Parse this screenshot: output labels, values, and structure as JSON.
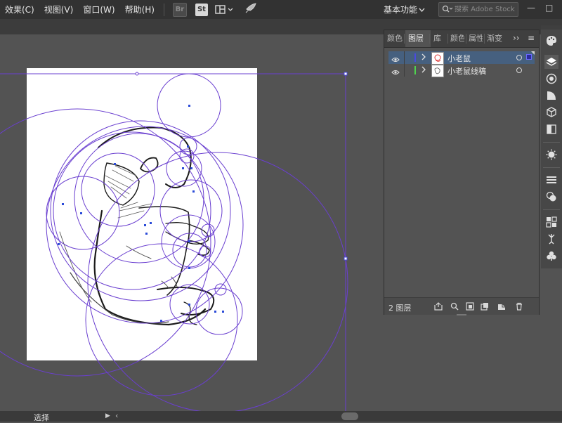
{
  "menubar": {
    "items": [
      "效果(C)",
      "视图(V)",
      "窗口(W)",
      "帮助(H)"
    ],
    "bridge_label": "Br",
    "stock_label": "St",
    "workspace": "基本功能",
    "search_placeholder": "搜索 Adobe Stock",
    "minimize": "—",
    "restore": "□"
  },
  "status": {
    "tool": "选择",
    "arrow": "▶",
    "scroll_left": "‹"
  },
  "layers_panel": {
    "tabs": [
      "颜色",
      "图层",
      "库",
      "颜色",
      "属性",
      "渐变"
    ],
    "active_tab": "图层",
    "overflow": "››",
    "menu": "≡",
    "layers": [
      {
        "name": "小老鼠",
        "color": "#4a4adf",
        "selected": true
      },
      {
        "name": "小老鼠线稿",
        "color": "#4fd34f",
        "selected": false
      }
    ],
    "footer_count": "2 图层"
  },
  "colors": {
    "selection": "#6a3fd0",
    "anchor": "#2b4bd8",
    "artboard": "#ffffff",
    "canvas": "#535353"
  },
  "icons": {
    "dock": [
      "palette-icon",
      "layers-icon",
      "swatches-icon",
      "gradient-icon",
      "3d-icon",
      "align-icon",
      "transparency-icon",
      "stroke-icon",
      "appearance-icon",
      "pathfinder-icon",
      "puppet-icon",
      "symbols-icon"
    ]
  }
}
